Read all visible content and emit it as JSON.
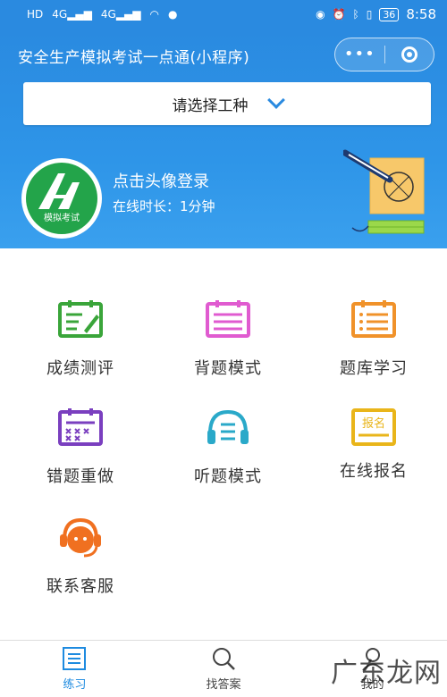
{
  "status_bar": {
    "signal_labels": [
      "HD",
      "4G",
      "4G"
    ],
    "battery": "36",
    "time": "8:58"
  },
  "header": {
    "title": "安全生产模拟考试一点通(小程序)",
    "capsule_more": "•••",
    "select_placeholder": "请选择工种"
  },
  "profile": {
    "avatar_label": "模拟考试",
    "login_prompt": "点击头像登录",
    "online_time": "在线时长：1分钟"
  },
  "menu": [
    {
      "label": "成绩测评",
      "icon": "report-card-icon",
      "color": "#3aa53a"
    },
    {
      "label": "背题模式",
      "icon": "notebook-icon",
      "color": "#e05bd0"
    },
    {
      "label": "题库学习",
      "icon": "question-bank-icon",
      "color": "#f0922a"
    },
    {
      "label": "错题重做",
      "icon": "wrong-answers-icon",
      "color": "#7a3fbf"
    },
    {
      "label": "听题模式",
      "icon": "headphones-icon",
      "color": "#2aa9c9"
    },
    {
      "label": "在线报名",
      "icon": "register-icon",
      "color": "#e9b51a",
      "icon_text": "报名"
    },
    {
      "label": "联系客服",
      "icon": "customer-service-icon",
      "color": "#f07020"
    }
  ],
  "tabs": [
    {
      "label": "练习",
      "icon": "practice-icon"
    },
    {
      "label": "找答案",
      "icon": "search-icon"
    },
    {
      "label": "我的",
      "icon": "profile-icon"
    }
  ],
  "watermark": "广东龙网",
  "colors": {
    "primary": "#2a8ae0",
    "tab_active": "#1e8be0"
  }
}
